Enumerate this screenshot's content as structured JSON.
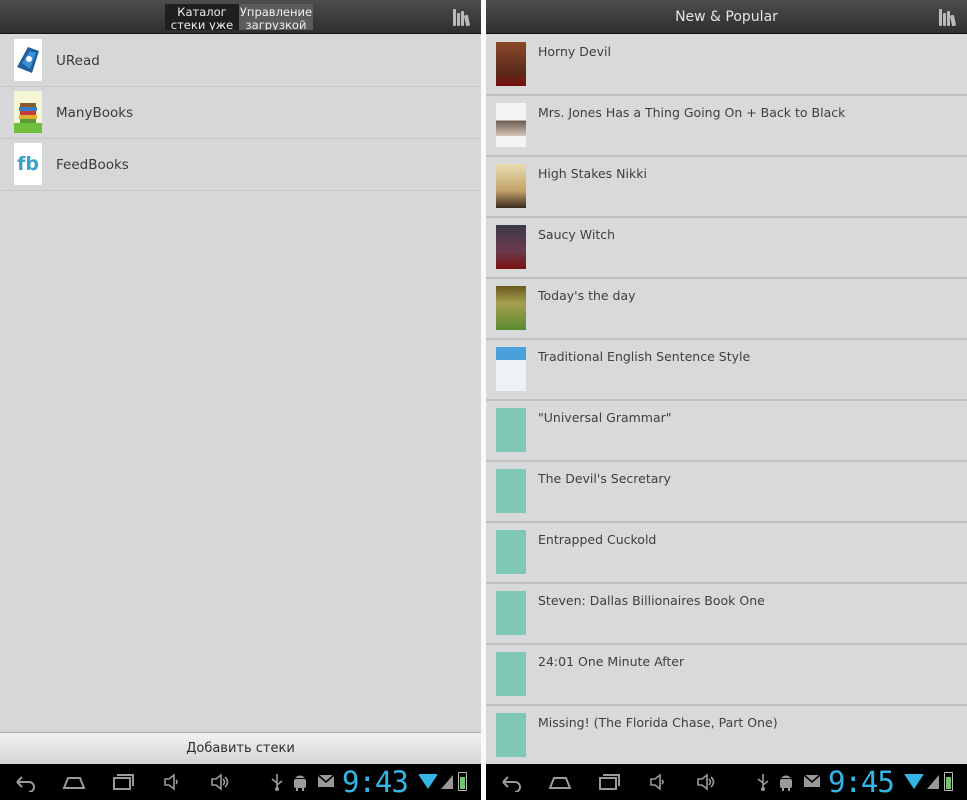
{
  "left_screen": {
    "tabs": [
      {
        "label": "Каталог стеки уже",
        "selected": true
      },
      {
        "label": "Управление загрузкой",
        "selected": false
      }
    ],
    "catalogs": [
      {
        "label": "URead",
        "icon": "uread-logo-icon"
      },
      {
        "label": "ManyBooks",
        "icon": "manybooks-logo-icon"
      },
      {
        "label": "FeedBooks",
        "icon": "feedbooks-logo-icon",
        "logo_text": "fb"
      }
    ],
    "add_button_label": "Добавить стеки",
    "clock": "9:43"
  },
  "right_screen": {
    "title": "New & Popular",
    "books": [
      {
        "title": "Horny Devil"
      },
      {
        "title": "Mrs. Jones Has a Thing Going On + Back to Black"
      },
      {
        "title": "High Stakes Nikki"
      },
      {
        "title": "Saucy Witch"
      },
      {
        "title": "Today's the day"
      },
      {
        "title": "Traditional English Sentence Style"
      },
      {
        "title": "\"Universal Grammar\""
      },
      {
        "title": "The Devil's Secretary"
      },
      {
        "title": "Entrapped Cuckold"
      },
      {
        "title": "Steven:  Dallas Billionaires Book One"
      },
      {
        "title": "24:01 One Minute After"
      },
      {
        "title": "Missing! (The Florida Chase, Part One)"
      }
    ],
    "clock": "9:45"
  },
  "colors": {
    "accent": "#33b5e5",
    "actionbar": "#3a3b3d",
    "list_bg": "#d6d7d9",
    "cover_teal": "#7fc8b4"
  },
  "navbar_icons": [
    "back-icon",
    "home-icon",
    "recent-apps-icon",
    "volume-down-icon",
    "volume-up-icon",
    "usb-icon",
    "android-debug-icon",
    "mail-icon",
    "wifi-icon",
    "battery-icon"
  ]
}
